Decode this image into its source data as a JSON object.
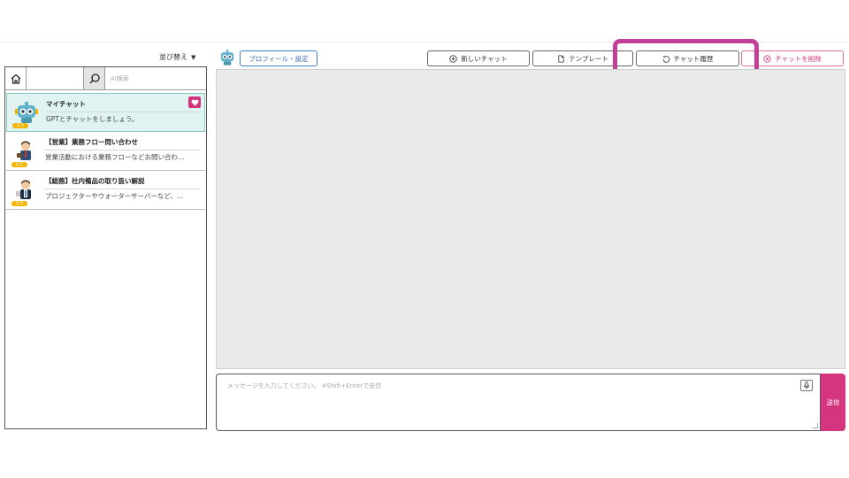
{
  "sidebar": {
    "sort_label": "並び替え",
    "search_placeholder": "AI検索",
    "bots": [
      {
        "name": "マイチャット",
        "desc": "GPTとチャットをしましょう。",
        "level": "0.0",
        "selected": true,
        "favorite": true
      },
      {
        "name": "【営業】業務フロー問い合わせ",
        "desc": "営業活動における業務フローなどお問い合わ…",
        "level": "0.0"
      },
      {
        "name": "【総務】社内備品の取り扱い解説",
        "desc": "プロジェクターやウォーターサーバーなど、…",
        "level": "0.0"
      }
    ]
  },
  "toolbar": {
    "profile_label": "プロフィール・設定",
    "new_chat_label": "新しいチャット",
    "template_label": "テンプレート",
    "history_label": "チャット履歴",
    "delete_label": "チャットを削除"
  },
  "composer": {
    "placeholder": "メッセージを入力してください。 ※Shift+Enterで送信",
    "send_label": "送信"
  },
  "colors": {
    "accent": "#d4357e",
    "highlight": "#c23e97",
    "selected_bg": "#dff3f1",
    "chat_bg": "#e9ebea",
    "profile_blue": "#3f7fc7",
    "badge": "#f6b500"
  },
  "icons": {
    "home": "home-icon",
    "search": "search-icon",
    "heart": "heart-icon",
    "new_chat": "plus-circle-icon",
    "template": "document-icon",
    "history": "history-icon",
    "delete": "x-circle-icon",
    "mic": "mic-icon"
  }
}
